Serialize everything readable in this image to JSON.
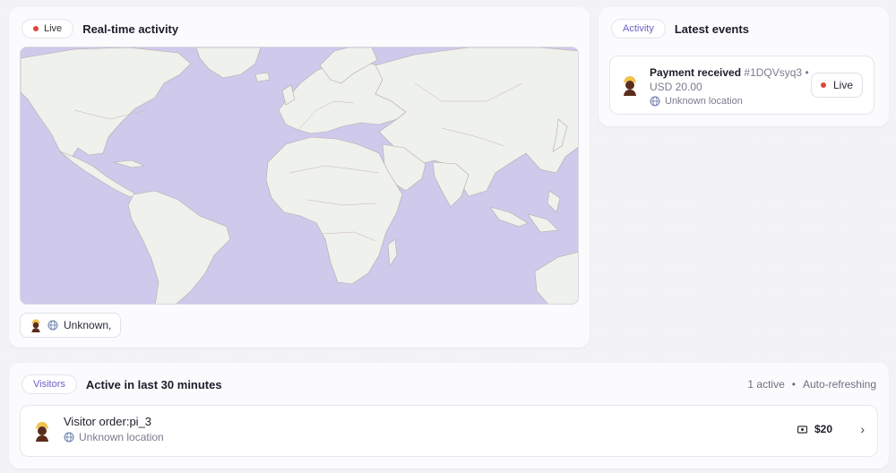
{
  "realtime": {
    "badge": "Live",
    "title": "Real-time activity",
    "location_chip": "Unknown,"
  },
  "activity": {
    "tab": "Activity",
    "title": "Latest events",
    "event": {
      "title": "Payment received",
      "id": "#1DQVsyq3",
      "separator": "•",
      "amount": "USD 20.00",
      "location": "Unknown location",
      "status": "Live"
    }
  },
  "visitors": {
    "tab": "Visitors",
    "title": "Active in last 30 minutes",
    "active_count": "1 active",
    "separator": "•",
    "refresh": "Auto-refreshing",
    "item": {
      "name": "Visitor order:pi_3",
      "location": "Unknown location",
      "amount": "$20"
    }
  },
  "colors": {
    "live_dot": "#e0443a",
    "ocean": "#cfc9ec",
    "land": "#eef1ec",
    "accent": "#6a5fc7"
  },
  "icons": [
    "live-dot-icon",
    "globe-icon",
    "avatar-icon",
    "cash-icon",
    "chevron-right-icon"
  ]
}
